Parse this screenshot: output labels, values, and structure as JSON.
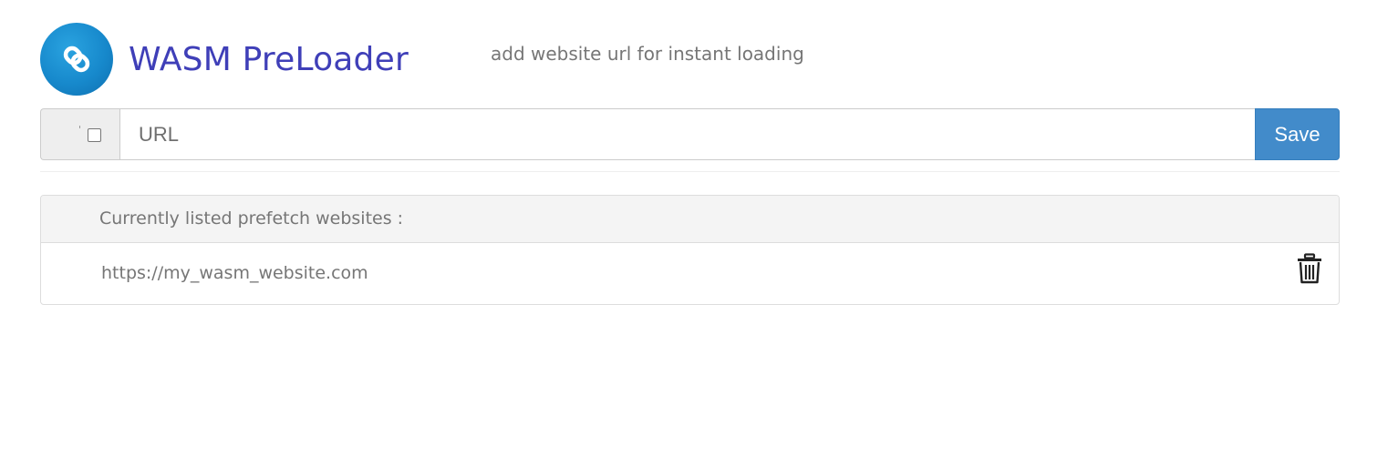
{
  "header": {
    "logo_icon": "link-icon",
    "title": "WASM PreLoader",
    "subtitle": "add website url for instant loading"
  },
  "input_bar": {
    "checkbox_checked": false,
    "url_placeholder": "URL",
    "url_value": "",
    "save_label": "Save",
    "save_color": "#428bca"
  },
  "prefetch_list": {
    "heading": "Currently listed prefetch websites :",
    "items": [
      {
        "url": "https://my_wasm_website.com",
        "delete_icon": "trash-icon"
      }
    ]
  },
  "colors": {
    "title": "#3f3fb8",
    "logo": "#1789cc",
    "muted_text": "#767676"
  }
}
